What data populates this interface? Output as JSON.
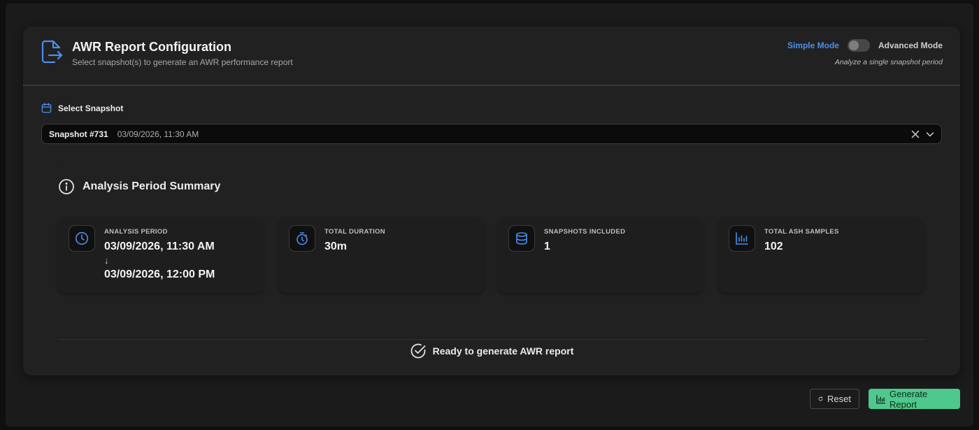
{
  "header": {
    "title": "AWR Report Configuration",
    "subtitle": "Select snapshot(s) to generate an AWR performance report",
    "icon": "file-export-icon"
  },
  "mode": {
    "simple_label": "Simple Mode",
    "advanced_label": "Advanced Mode",
    "hint": "Analyze a single snapshot period",
    "active": "simple"
  },
  "snapshot_select": {
    "label": "Select Snapshot",
    "selected_name": "Snapshot #731",
    "selected_date": "03/09/2026, 11:30 AM"
  },
  "summary": {
    "title": "Analysis Period Summary",
    "stats": [
      {
        "label": "ANALYSIS PERIOD",
        "value_start": "03/09/2026, 11:30 AM",
        "arrow": "↓",
        "value_end": "03/09/2026, 12:00 PM",
        "icon": "clock-icon"
      },
      {
        "label": "TOTAL DURATION",
        "value": "30m",
        "icon": "stopwatch-icon"
      },
      {
        "label": "SNAPSHOTS INCLUDED",
        "value": "1",
        "icon": "database-icon"
      },
      {
        "label": "TOTAL ASH SAMPLES",
        "value": "102",
        "icon": "bar-chart-icon"
      }
    ],
    "ready_text": "Ready to generate AWR report"
  },
  "actions": {
    "reset_label": "Reset",
    "generate_label": "Generate Report"
  },
  "colors": {
    "accent_blue": "#4a8ff0",
    "generate_green": "#4ec88c",
    "card_bg": "#212121"
  }
}
